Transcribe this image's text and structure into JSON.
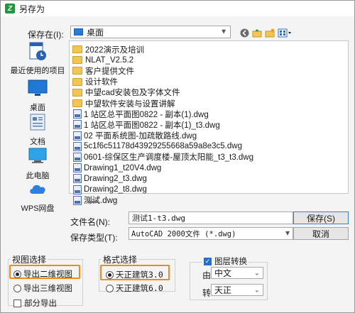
{
  "window": {
    "title": "另存为",
    "app_icon_letter": "Z"
  },
  "location": {
    "label": "保存在(I):",
    "value": "桌面"
  },
  "places": [
    {
      "name": "recent",
      "label": "最近使用的项目"
    },
    {
      "name": "desktop",
      "label": "桌面"
    },
    {
      "name": "documents",
      "label": "文档"
    },
    {
      "name": "this-pc",
      "label": "此电脑"
    },
    {
      "name": "wps",
      "label": "WPS网盘"
    }
  ],
  "files": [
    {
      "type": "folder",
      "name": "2022演示及培训"
    },
    {
      "type": "folder",
      "name": "NLAT_V2.5.2"
    },
    {
      "type": "folder",
      "name": "客户提供文件"
    },
    {
      "type": "folder",
      "name": "设计软件"
    },
    {
      "type": "folder",
      "name": "中望cad安装包及字体文件"
    },
    {
      "type": "folder",
      "name": "中望软件安装与设置讲解"
    },
    {
      "type": "dwg",
      "name": "1 站区总平面图0822 - 副本(1).dwg"
    },
    {
      "type": "dwg",
      "name": "1 站区总平面图0822 - 副本(1)_t3.dwg"
    },
    {
      "type": "dwg",
      "name": "02 平面系统图-加疏散路线.dwg"
    },
    {
      "type": "dwg",
      "name": "5c1f6c51178d43929255668a59a8e3c5.dwg"
    },
    {
      "type": "dwg",
      "name": "0601-综保区生产调度楼-屋顶太阳能_t3_t3.dwg"
    },
    {
      "type": "dwg",
      "name": "Drawing1_t20V4.dwg"
    },
    {
      "type": "dwg",
      "name": "Drawing2_t3.dwg"
    },
    {
      "type": "dwg",
      "name": "Drawing2_t8.dwg"
    },
    {
      "type": "dwg",
      "name": "测试.dwg"
    }
  ],
  "filename": {
    "label": "文件名(N):",
    "value": "测试1-t3.dwg"
  },
  "filetype": {
    "label": "保存类型(T):",
    "value": "AutoCAD 2000文件 (*.dwg)"
  },
  "buttons": {
    "save": "保存(S)",
    "cancel": "取消"
  },
  "view_group": {
    "title": "视图选择",
    "opt1": "导出二维视图",
    "opt2": "导出三维视图",
    "selected": "导出二维视图",
    "partial_label": "部分导出",
    "partial_checked": false
  },
  "format_group": {
    "title": "格式选择",
    "opt1": "天正建筑3.0",
    "opt2": "天正建筑6.0",
    "selected": "天正建筑3.0"
  },
  "layer_group": {
    "title": "图层转换",
    "checked": true,
    "from_label": "由",
    "from_value": "中文",
    "to_label": "转",
    "to_value": "天正"
  },
  "colors": {
    "highlight": "#f08a1e",
    "check_blue": "#1f6fd0"
  }
}
